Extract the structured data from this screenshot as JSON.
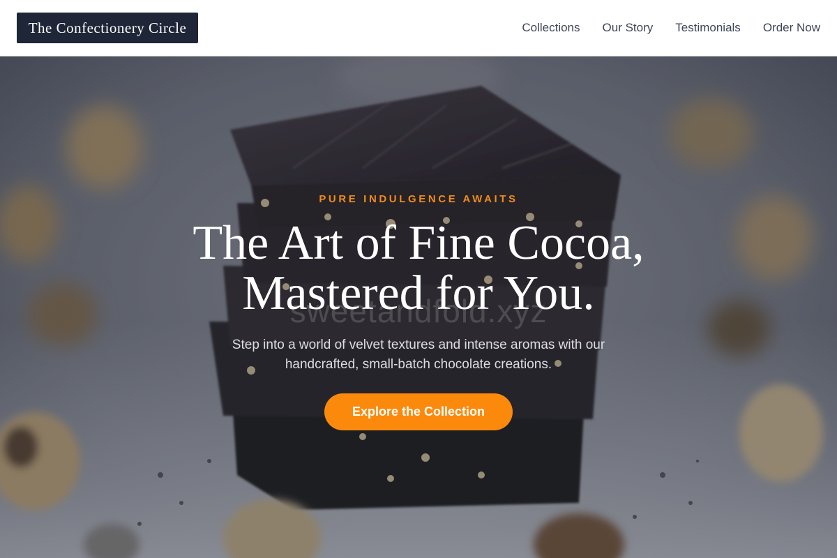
{
  "header": {
    "logo_text": "The Confectionery Circle",
    "nav": [
      "Collections",
      "Our Story",
      "Testimonials",
      "Order Now"
    ]
  },
  "hero": {
    "eyebrow": "PURE INDULGENCE AWAITS",
    "headline_line1": "The Art of Fine Cocoa,",
    "headline_line2": "Mastered for You.",
    "watermark": "sweetandfold.xyz",
    "subtext": "Step into a world of velvet textures and intense aromas with our handcrafted, small-batch chocolate creations.",
    "cta_label": "Explore the Collection"
  },
  "colors": {
    "accent": "#f08c1a",
    "button": "#fb8a0c",
    "logo_bg": "#1e2638",
    "nav_text": "#3d4659"
  }
}
